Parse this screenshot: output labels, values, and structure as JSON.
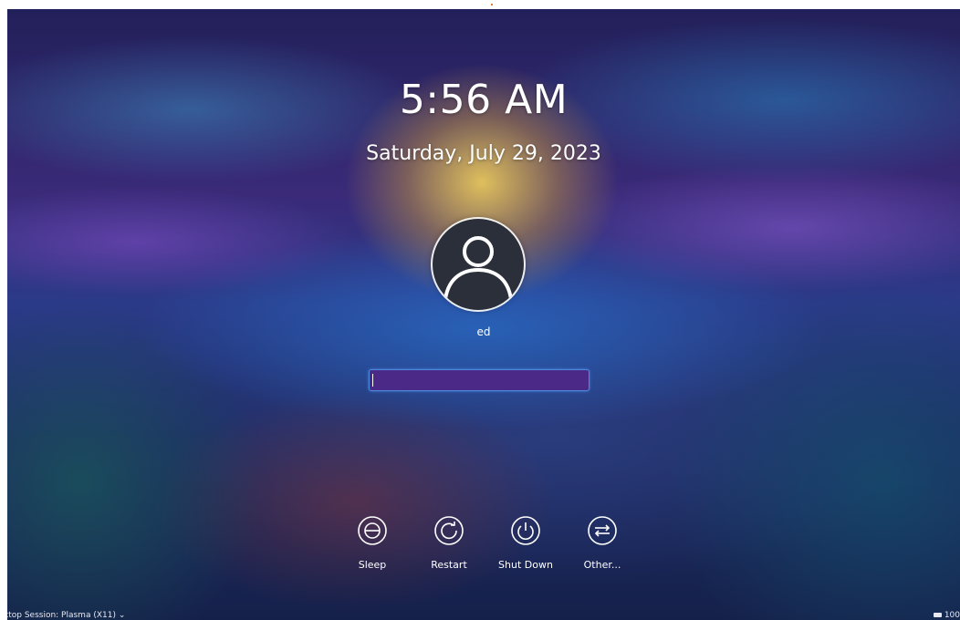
{
  "clock": {
    "time": "5:56 AM",
    "date": "Saturday, July 29, 2023"
  },
  "user": {
    "name": "ed",
    "avatar_icon": "user-icon"
  },
  "password": {
    "value": "",
    "placeholder": ""
  },
  "actions": [
    {
      "label": "Sleep",
      "icon": "sleep-icon"
    },
    {
      "label": "Restart",
      "icon": "restart-icon"
    },
    {
      "label": "Shut Down",
      "icon": "power-icon"
    },
    {
      "label": "Other...",
      "icon": "switch-user-icon"
    }
  ],
  "footer": {
    "session": "ktop Session: Plasma (X11)",
    "session_chevron": "chevron-down-icon",
    "battery": "100"
  },
  "colors": {
    "accent": "#4a8ae0",
    "field_bg": "#4a2a86",
    "text": "#ffffff"
  }
}
